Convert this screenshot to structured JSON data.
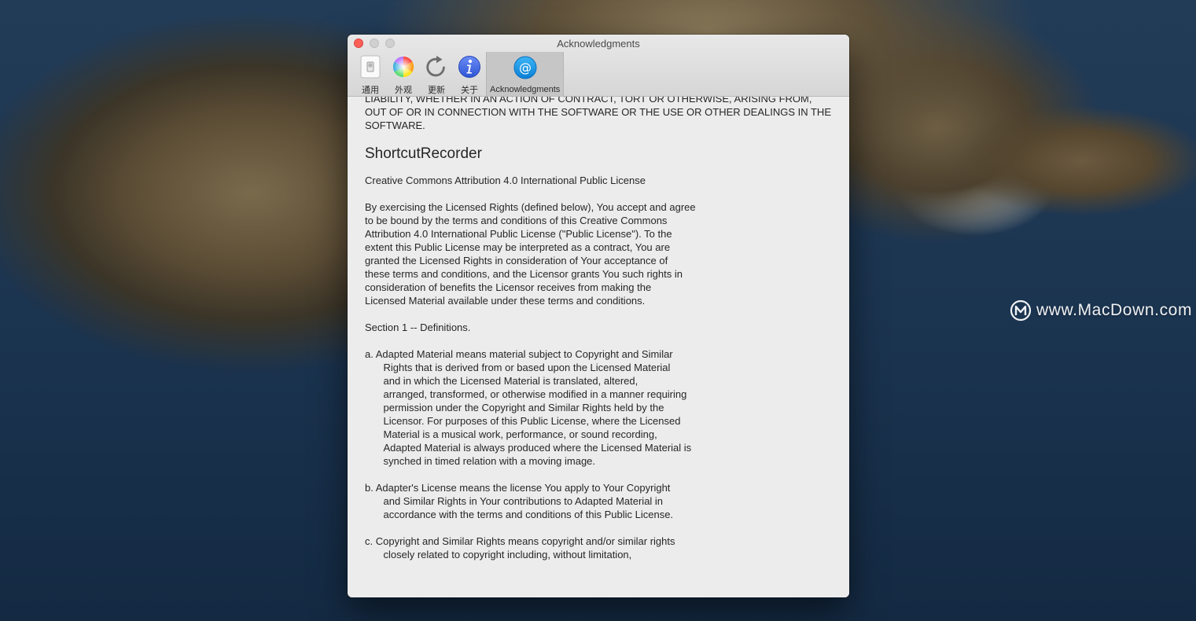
{
  "window": {
    "title": "Acknowledgments"
  },
  "toolbar": {
    "items": [
      {
        "label": "通用",
        "icon": "switch-icon"
      },
      {
        "label": "外观",
        "icon": "color-wheel-icon"
      },
      {
        "label": "更新",
        "icon": "refresh-icon"
      },
      {
        "label": "关于",
        "icon": "info-icon"
      },
      {
        "label": "Acknowledgments",
        "icon": "at-sign-icon",
        "active": true
      }
    ]
  },
  "content": {
    "top_paragraph": "LIABILITY, WHETHER IN AN ACTION OF CONTRACT, TORT OR OTHERWISE, ARISING FROM,\nOUT OF OR IN CONNECTION WITH THE SOFTWARE OR THE USE OR OTHER DEALINGS IN THE\nSOFTWARE.",
    "heading": "ShortcutRecorder",
    "license_name": "Creative Commons Attribution 4.0 International Public License",
    "intro": "By exercising the Licensed Rights (defined below), You accept and agree\nto be bound by the terms and conditions of this Creative Commons\nAttribution 4.0 International Public License (\"Public License\"). To the\nextent this Public License may be interpreted as a contract, You are\ngranted the Licensed Rights in consideration of Your acceptance of\nthese terms and conditions, and the Licensor grants You such rights in\nconsideration of benefits the Licensor receives from making the\nLicensed Material available under these terms and conditions.",
    "section_title": "Section 1 -- Definitions.",
    "def_a_first": "a. Adapted Material means material subject to Copyright and Similar",
    "def_a_rest": "Rights that is derived from or based upon the Licensed Material\nand in which the Licensed Material is translated, altered,\narranged, transformed, or otherwise modified in a manner requiring\npermission under the Copyright and Similar Rights held by the\nLicensor. For purposes of this Public License, where the Licensed\nMaterial is a musical work, performance, or sound recording,\nAdapted Material is always produced where the Licensed Material is\nsynched in timed relation with a moving image.",
    "def_b_first": "b. Adapter's License means the license You apply to Your Copyright",
    "def_b_rest": "and Similar Rights in Your contributions to Adapted Material in\naccordance with the terms and conditions of this Public License.",
    "def_c_first": "c. Copyright and Similar Rights means copyright and/or similar rights",
    "def_c_rest": "closely related to copyright including, without limitation,"
  },
  "watermark": {
    "text": "www.MacDown.com",
    "icon": "macdown-logo-icon"
  }
}
